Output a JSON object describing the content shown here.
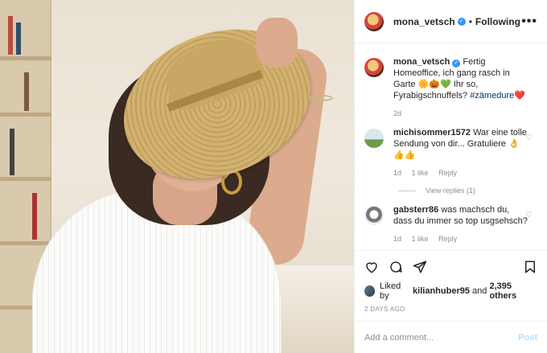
{
  "post": {
    "author": "mona_vetsch",
    "follow_status": "Following",
    "more": "•••"
  },
  "caption": {
    "author": "mona_vetsch",
    "text": "Fertig Homeoffice, ich gang rasch in Garte 🌼🎃💚 Ihr so, Fyrabigschnuffels? ",
    "hashtag": "#zämedure❤️",
    "age": "2d"
  },
  "comments": [
    {
      "author": "michisommer1572",
      "text": "War eine tolle Sendung von dir... Gratuliere 👌👍👍",
      "age": "1d",
      "likes": "1 like",
      "reply": "Reply",
      "view_replies": "View replies (1)"
    },
    {
      "author": "gabsterr86",
      "text": "was machsch du, dass du immer so top usgsehsch?",
      "age": "1d",
      "likes": "1 like",
      "reply": "Reply"
    }
  ],
  "likes": {
    "prefix": "Liked by",
    "user": "kilianhuber95",
    "and": "and",
    "others": "2,395 others"
  },
  "timestamp": "2 DAYS AGO",
  "add_comment": {
    "placeholder": "Add a comment...",
    "post_label": "Post"
  },
  "colors": {
    "link": "#00376b",
    "post_disabled": "#b2dffc",
    "verified": "#3897f0"
  },
  "icons": [
    "heart-icon",
    "comment-icon",
    "share-icon",
    "bookmark-icon"
  ]
}
